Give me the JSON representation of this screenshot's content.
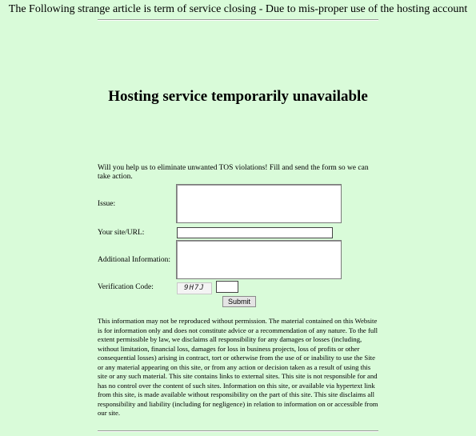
{
  "banner": {
    "text": "The Following strange article is term of service closing - Due to mis-proper use of the hosting account"
  },
  "main": {
    "title": "Hosting service temporarily unavailable",
    "intro": "Will you help us to eliminate unwanted TOS violations! Fill and send the form so we can take action."
  },
  "form": {
    "issue_label": "Issue:",
    "issue_value": "",
    "url_label": "Your site/URL:",
    "url_value": "",
    "info_label": "Additional Information:",
    "info_value": "",
    "code_label": "Verification Code:",
    "captcha_text": "9H7J",
    "code_value": "",
    "submit_label": "Submit"
  },
  "disclaimer": "This information may not be reproduced without permission. The material contained on this Website is for information only and does not constitute advice or a recommendation of any nature. To the full extent permissible by law, we disclaims all responsibility for any damages or losses (including, without limitation, financial loss, damages for loss in business projects, loss of profits or other consequential losses) arising in contract, tort or otherwise from the use of or inability to use the Site or any material appearing on this site, or from any action or decision taken as a result of using this site or any such material. This site contains links to external sites. This site is not responsible for and has no control over the content of such sites. Information on this site, or available via hypertext link from this site, is made available without responsibility on the part of this site. This site disclaims all responsibility and liability (including for negligence) in relation to information on or accessible from our site."
}
